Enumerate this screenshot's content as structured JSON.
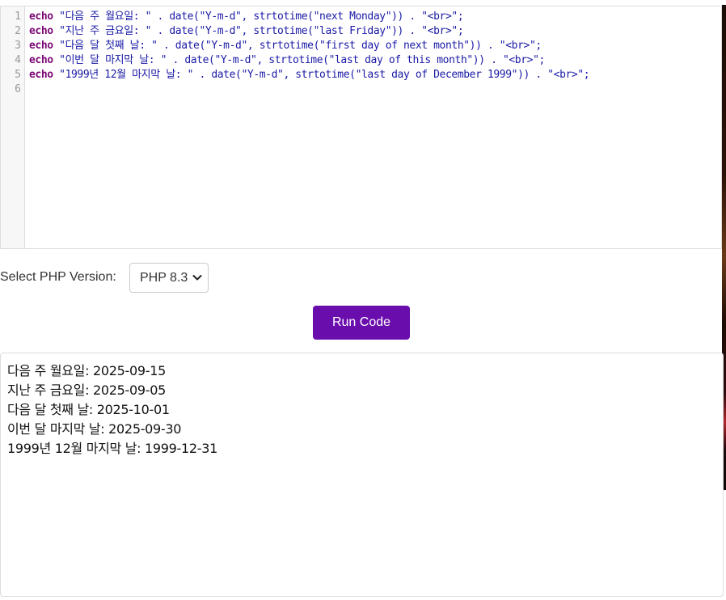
{
  "editor": {
    "line_numbers": [
      "1",
      "2",
      "3",
      "4",
      "5",
      "6"
    ],
    "lines": [
      {
        "keyword": "echo",
        "rest": " \"다음 주 월요일: \" . date(\"Y-m-d\", strtotime(\"next Monday\")) . \"<br>\";"
      },
      {
        "keyword": "echo",
        "rest": " \"지난 주 금요일: \" . date(\"Y-m-d\", strtotime(\"last Friday\")) . \"<br>\";"
      },
      {
        "keyword": "echo",
        "rest": " \"다음 달 첫째 날: \" . date(\"Y-m-d\", strtotime(\"first day of next month\")) . \"<br>\";"
      },
      {
        "keyword": "echo",
        "rest": " \"이번 달 마지막 날: \" . date(\"Y-m-d\", strtotime(\"last day of this month\")) . \"<br>\";"
      },
      {
        "keyword": "echo",
        "rest": " \"1999년 12월 마지막 날: \" . date(\"Y-m-d\", strtotime(\"last day of December 1999\")) . \"<br>\";"
      },
      {
        "keyword": "",
        "rest": ""
      }
    ]
  },
  "controls": {
    "version_label": "Select PHP Version:",
    "version_selected": "PHP 8.3",
    "run_label": "Run Code"
  },
  "output": {
    "lines": [
      "다음 주 월요일: 2025-09-15",
      "지난 주 금요일: 2025-09-05",
      "다음 달 첫째 날: 2025-10-01",
      "이번 달 마지막 날: 2025-09-30",
      "1999년 12월 마지막 날: 1999-12-31"
    ]
  },
  "colors": {
    "run_button": "#6a0dad",
    "keyword": "#7a0874",
    "string": "#1a1aa6"
  }
}
